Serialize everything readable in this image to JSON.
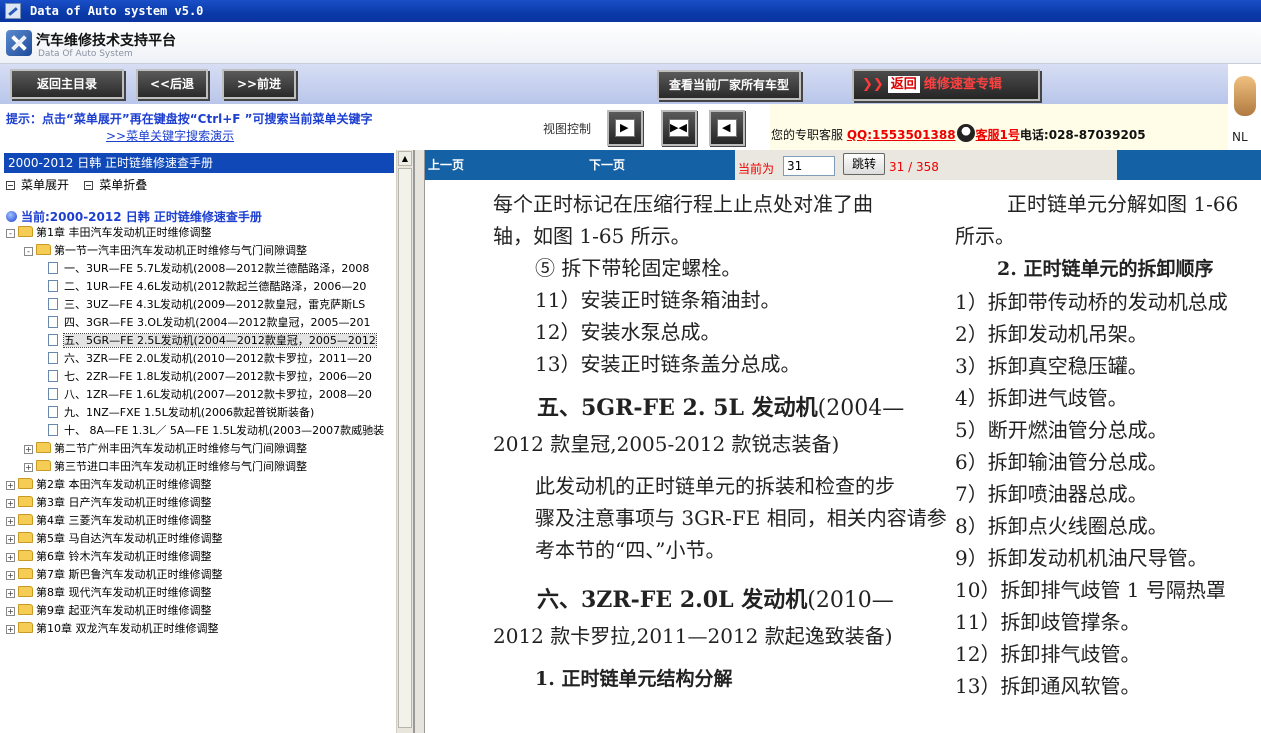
{
  "window": {
    "title": "Data of Auto system v5.0"
  },
  "brand": {
    "title_cn": "汽车维修技术支持平台",
    "title_en": "Data Of Auto System"
  },
  "toolbar": {
    "home": "返回主目录",
    "back": "<<后退",
    "forward": ">>前进",
    "all_models": "查看当前厂家所有车型",
    "return_label": "返回",
    "return_target": "维修速查专辑"
  },
  "hint": {
    "text": "提示：点击“菜单展开”再在键盘按“Ctrl+F ”可搜索当前菜单关键字",
    "demo": ">>菜单关键字搜索演示"
  },
  "view": {
    "label": "视图控制"
  },
  "service": {
    "label": "您的专职客服",
    "qq": "QQ:1553501388",
    "cs": "客服1号",
    "phone_label": "电话:",
    "phone": "028-87039205"
  },
  "figure_label": "NL",
  "sidebar": {
    "header": "2000-2012 日韩  正时链维修速查手册",
    "expand": "菜单展开",
    "collapse": "菜单折叠",
    "current": "当前:2000-2012 日韩  正时链维修速查手册",
    "tree": [
      {
        "label": "第1章  丰田汽车发动机正时维修调整",
        "level": 0,
        "toggle": "-",
        "kind": "folder"
      },
      {
        "label": "第一节一汽丰田汽车发动机正时维修与气门间隙调整",
        "level": 1,
        "toggle": "-",
        "kind": "folder"
      },
      {
        "label": "一、3UR—FE 5.7L发动机(2008—2012款兰德酷路泽，2008",
        "level": 2,
        "kind": "page"
      },
      {
        "label": "二、1UR—FE 4.6L发动机(2012款起兰德酷路泽，2006—20",
        "level": 2,
        "kind": "page"
      },
      {
        "label": "三、3UZ—FE 4.3L发动机(2009—2012款皇冠，雷克萨斯LS",
        "level": 2,
        "kind": "page"
      },
      {
        "label": "四、3GR—FE 3.OL发动机(2004—2012款皇冠，2005—201",
        "level": 2,
        "kind": "page"
      },
      {
        "label": "五、5GR—FE 2.5L发动机(2004—2012款皇冠，2005—2012",
        "level": 2,
        "kind": "page",
        "selected": true
      },
      {
        "label": "六、3ZR—FE 2.0L发动机(2010—2012款卡罗拉，2011—20",
        "level": 2,
        "kind": "page"
      },
      {
        "label": "七、2ZR—FE 1.8L发动机(2007—2012款卡罗拉，2006—20",
        "level": 2,
        "kind": "page"
      },
      {
        "label": "八、1ZR—FE 1.6L发动机(2007—2012款卡罗拉，2008—20",
        "level": 2,
        "kind": "page"
      },
      {
        "label": "九、1NZ—FXE 1.5L发动机(2006款起普锐斯装备)",
        "level": 2,
        "kind": "page"
      },
      {
        "label": "十、 8A—FE 1.3L／ 5A—FE 1.5L发动机(2003—2007款威驰装",
        "level": 2,
        "kind": "page"
      },
      {
        "label": "第二节广州丰田汽车发动机正时维修与气门间隙调整",
        "level": 1,
        "toggle": "+",
        "kind": "folder"
      },
      {
        "label": "第三节进口丰田汽车发动机正时维修与气门间隙调整",
        "level": 1,
        "toggle": "+",
        "kind": "folder"
      },
      {
        "label": "第2章  本田汽车发动机正时维修调整",
        "level": 0,
        "toggle": "+",
        "kind": "folder"
      },
      {
        "label": "第3章  日产汽车发动机正时维修调整",
        "level": 0,
        "toggle": "+",
        "kind": "folder"
      },
      {
        "label": "第4章  三菱汽车发动机正时维修调整",
        "level": 0,
        "toggle": "+",
        "kind": "folder"
      },
      {
        "label": "第5章  马自达汽车发动机正时维修调整",
        "level": 0,
        "toggle": "+",
        "kind": "folder"
      },
      {
        "label": "第6章  铃木汽车发动机正时维修调整",
        "level": 0,
        "toggle": "+",
        "kind": "folder"
      },
      {
        "label": "第7章  斯巴鲁汽车发动机正时维修调整",
        "level": 0,
        "toggle": "+",
        "kind": "folder"
      },
      {
        "label": "第8章  现代汽车发动机正时维修调整",
        "level": 0,
        "toggle": "+",
        "kind": "folder"
      },
      {
        "label": "第9章  起亚汽车发动机正时维修调整",
        "level": 0,
        "toggle": "+",
        "kind": "folder"
      },
      {
        "label": "第10章  双龙汽车发动机正时维修调整",
        "level": 0,
        "toggle": "+",
        "kind": "folder"
      }
    ]
  },
  "pager": {
    "prev": "上一页",
    "next": "下一页",
    "current_label": "当前为",
    "current_value": "31",
    "go": "跳转",
    "count": "31 / 358"
  },
  "doc": {
    "left": [
      {
        "t": "每个正时标记在压缩行程上止点处对准了曲"
      },
      {
        "t": "轴，如图 1-65 所示。"
      },
      {
        "t": "⑤  拆下带轮固定螺栓。"
      },
      {
        "t": "11）安装正时链条箱油封。"
      },
      {
        "t": "12）安装水泵总成。"
      },
      {
        "t": "13）安装正时链条盖分总成。"
      },
      {
        "h": "五、5GR-FE 2. 5L 发动机",
        "n": "(2004—"
      },
      {
        "t": "2012 款皇冠,2005-2012 款锐志装备)"
      },
      {
        "t": "此发动机的正时链单元的拆装和检查的步"
      },
      {
        "t": "骤及注意事项与 3GR-FE 相同，相关内容请参"
      },
      {
        "t": "考本节的“四、”小节。"
      },
      {
        "h": "六、3ZR-FE 2.0L 发动机",
        "n": "(2010—"
      },
      {
        "t": "2012 款卡罗拉,2011—2012 款起逸致装备)"
      },
      {
        "s": "1. 正时链单元结构分解"
      }
    ],
    "right": [
      {
        "t": "正时链单元分解如图 1-66"
      },
      {
        "t": "所示。"
      },
      {
        "s": "2. 正时链单元的拆卸顺序"
      },
      {
        "t": "1）拆卸带传动桥的发动机总成"
      },
      {
        "t": "2）拆卸发动机吊架。"
      },
      {
        "t": "3）拆卸真空稳压罐。"
      },
      {
        "t": "4）拆卸进气歧管。"
      },
      {
        "t": "5）断开燃油管分总成。"
      },
      {
        "t": "6）拆卸输油管分总成。"
      },
      {
        "t": "7）拆卸喷油器总成。"
      },
      {
        "t": "8）拆卸点火线圈总成。"
      },
      {
        "t": "9）拆卸发动机机油尺导管。"
      },
      {
        "t": "10）拆卸排气歧管 1 号隔热罩"
      },
      {
        "t": "11）拆卸歧管撑条。"
      },
      {
        "t": "12）拆卸排气歧管。"
      },
      {
        "t": "13）拆卸通风软管。"
      }
    ]
  }
}
